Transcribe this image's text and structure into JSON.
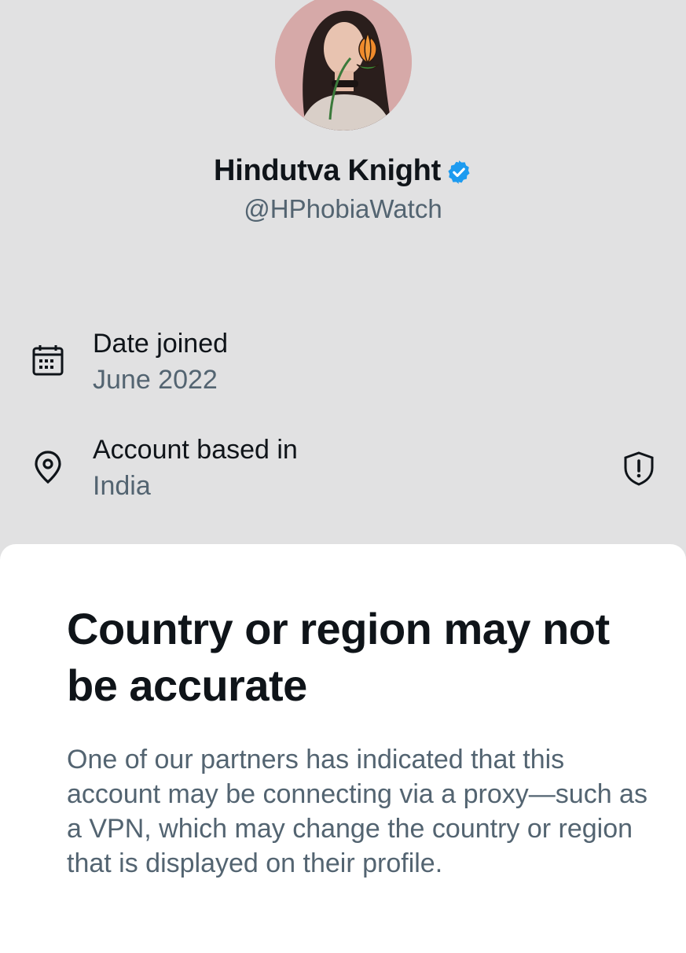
{
  "profile": {
    "name": "Hindutva Knight",
    "handle": "@HPhobiaWatch",
    "verified_color": "#1d9bf0"
  },
  "details": [
    {
      "icon": "calendar-icon",
      "label": "Date joined",
      "value": "June 2022"
    },
    {
      "icon": "location-pin-icon",
      "label": "Account based in",
      "value": "India",
      "badge_icon": "shield-alert-icon"
    }
  ],
  "sheet": {
    "title": "Country or region may not be accurate",
    "body": "One of our partners has indicated that this account may be connecting via a proxy—such as a VPN, which may change the country or region that is displayed on their profile."
  },
  "colors": {
    "background": "#e1e1e2",
    "primary_text": "#0f1419",
    "secondary_text": "#536471",
    "sheet_bg": "#ffffff"
  }
}
